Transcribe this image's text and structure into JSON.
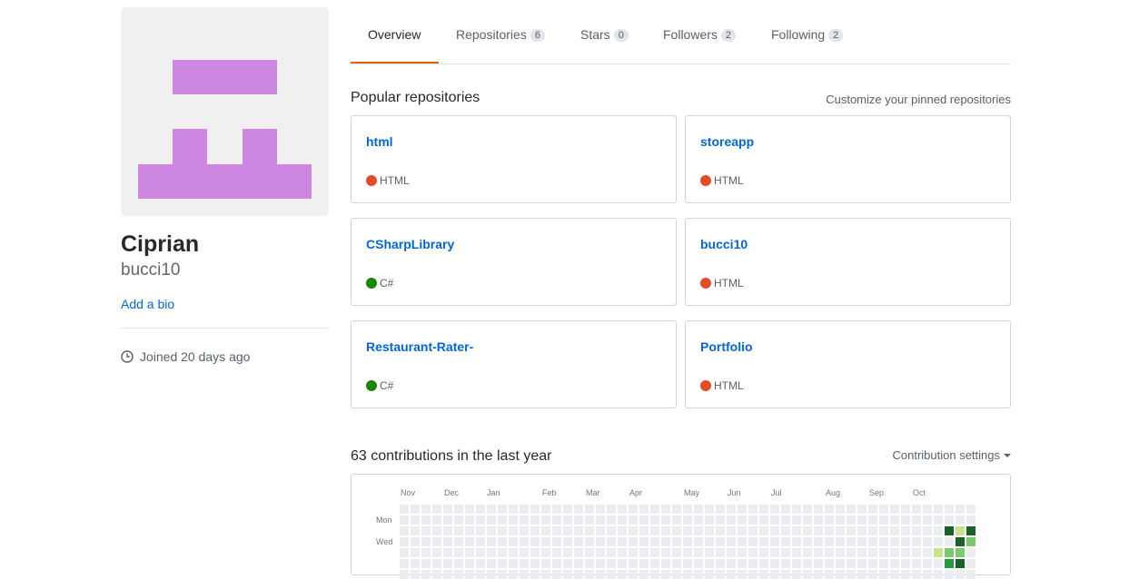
{
  "profile": {
    "fullname": "Ciprian",
    "username": "bucci10",
    "add_bio": "Add a bio",
    "joined": "Joined 20 days ago"
  },
  "tabs": [
    {
      "label": "Overview"
    },
    {
      "label": "Repositories",
      "count": "6"
    },
    {
      "label": "Stars",
      "count": "0"
    },
    {
      "label": "Followers",
      "count": "2"
    },
    {
      "label": "Following",
      "count": "2"
    }
  ],
  "popular": {
    "title": "Popular repositories",
    "customize": "Customize your pinned repositories",
    "repos": [
      {
        "name": "html",
        "language": "HTML",
        "color": "#e34c26"
      },
      {
        "name": "storeapp",
        "language": "HTML",
        "color": "#e34c26"
      },
      {
        "name": "CSharpLibrary",
        "language": "C#",
        "color": "#178600"
      },
      {
        "name": "bucci10",
        "language": "HTML",
        "color": "#e34c26"
      },
      {
        "name": "Restaurant-Rater-",
        "language": "C#",
        "color": "#178600"
      },
      {
        "name": "Portfolio",
        "language": "HTML",
        "color": "#e34c26"
      }
    ]
  },
  "contributions": {
    "title": "63 contributions in the last year",
    "settings": "Contribution settings",
    "months": [
      "Nov",
      "Dec",
      "Jan",
      "Feb",
      "Mar",
      "Apr",
      "May",
      "Jun",
      "Jul",
      "Aug",
      "Sep",
      "Oct"
    ],
    "days": [
      "Mon",
      "Wed"
    ],
    "colors": [
      "#ebedf0",
      "#c6e48b",
      "#7bc96f",
      "#239a3b",
      "#196127"
    ],
    "active_cells": [
      {
        "week": 50,
        "day": 2,
        "level": 4
      },
      {
        "week": 51,
        "day": 2,
        "level": 1
      },
      {
        "week": 52,
        "day": 2,
        "level": 4
      },
      {
        "week": 51,
        "day": 3,
        "level": 4
      },
      {
        "week": 52,
        "day": 3,
        "level": 2
      },
      {
        "week": 49,
        "day": 4,
        "level": 1
      },
      {
        "week": 50,
        "day": 4,
        "level": 2
      },
      {
        "week": 51,
        "day": 4,
        "level": 2
      },
      {
        "week": 50,
        "day": 5,
        "level": 3
      },
      {
        "week": 51,
        "day": 5,
        "level": 4
      }
    ]
  }
}
